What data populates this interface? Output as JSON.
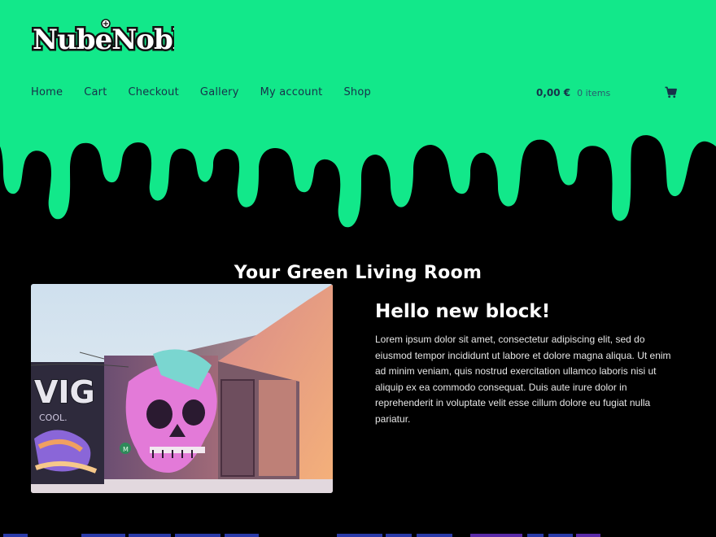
{
  "site": {
    "logo_text": "NubeNoble",
    "brand_color": "#12e88a",
    "text_color": "#17324a"
  },
  "nav": {
    "items": [
      {
        "label": "Home"
      },
      {
        "label": "Cart"
      },
      {
        "label": "Checkout"
      },
      {
        "label": "Gallery"
      },
      {
        "label": "My account"
      },
      {
        "label": "Shop"
      }
    ]
  },
  "cart": {
    "total": "0,00 €",
    "count": "0 items",
    "icon": "shopping-cart-icon"
  },
  "main": {
    "section_title": "Your Green Living Room",
    "image_alt": "Graffiti skull mural on a warehouse wall",
    "block_heading": "Hello new block!",
    "block_text": "Lorem ipsum dolor sit amet, consectetur adipiscing elit, sed do eiusmod tempor incididunt ut labore et dolore magna aliqua. Ut enim ad minim veniam, quis nostrud exercitation ullamco laboris nisi ut aliquip ex ea commodo consequat. Duis aute irure dolor in reprehenderit in voluptate velit esse cillum dolore eu fugiat nulla pariatur."
  }
}
